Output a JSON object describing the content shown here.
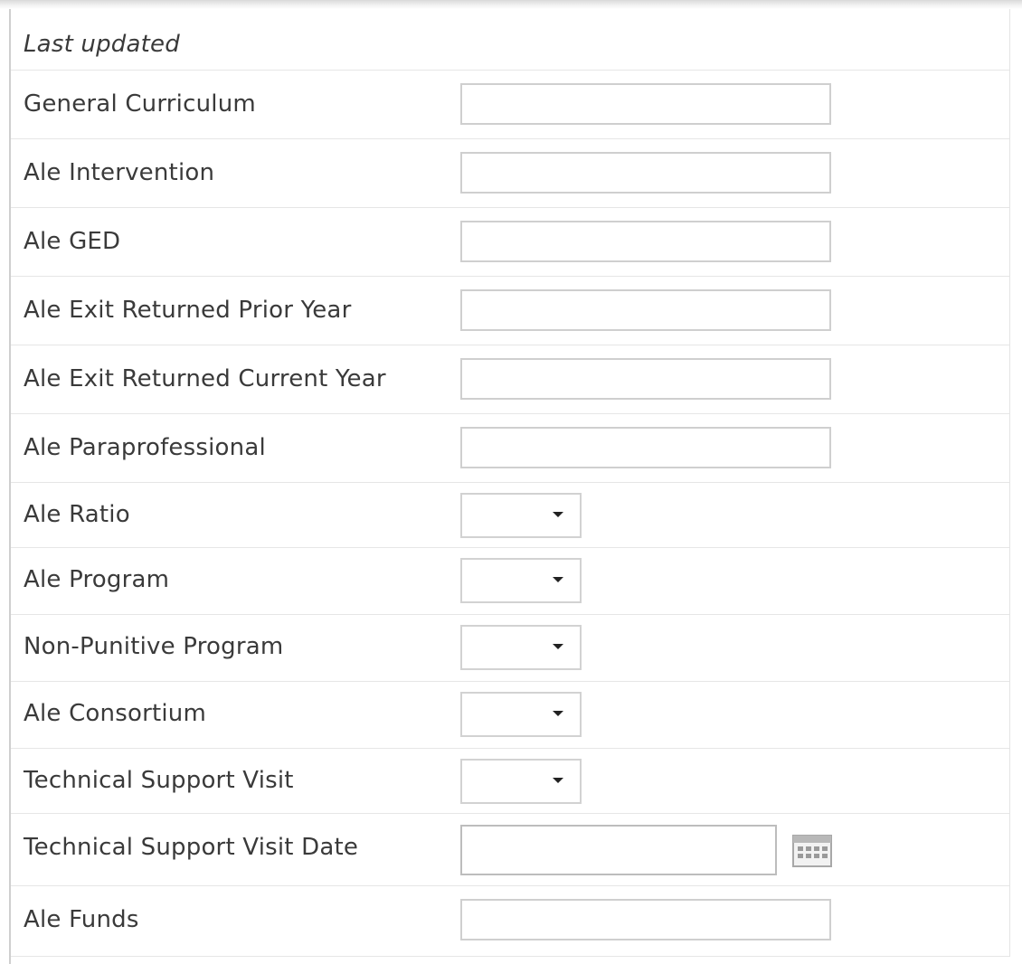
{
  "header": {
    "last_updated_label": "Last updated"
  },
  "fields": [
    {
      "label": "General Curriculum",
      "type": "text",
      "value": ""
    },
    {
      "label": "Ale Intervention",
      "type": "text",
      "value": ""
    },
    {
      "label": "Ale GED",
      "type": "text",
      "value": ""
    },
    {
      "label": "Ale Exit Returned Prior Year",
      "type": "text",
      "value": ""
    },
    {
      "label": "Ale Exit Returned Current Year",
      "type": "text",
      "value": ""
    },
    {
      "label": "Ale Paraprofessional",
      "type": "text",
      "value": ""
    },
    {
      "label": "Ale Ratio",
      "type": "select",
      "value": ""
    },
    {
      "label": "Ale Program",
      "type": "select",
      "value": ""
    },
    {
      "label": "Non-Punitive Program",
      "type": "select",
      "value": ""
    },
    {
      "label": "Ale Consortium",
      "type": "select",
      "value": ""
    },
    {
      "label": "Technical Support Visit",
      "type": "select",
      "value": ""
    },
    {
      "label": "Technical Support Visit Date",
      "type": "date",
      "value": "",
      "icon": "calendar-icon"
    },
    {
      "label": "Ale Funds",
      "type": "text",
      "value": ""
    }
  ],
  "colors": {
    "border": "#cfcfcf",
    "divider": "#e6e6e6",
    "text": "#3a3a3a"
  }
}
